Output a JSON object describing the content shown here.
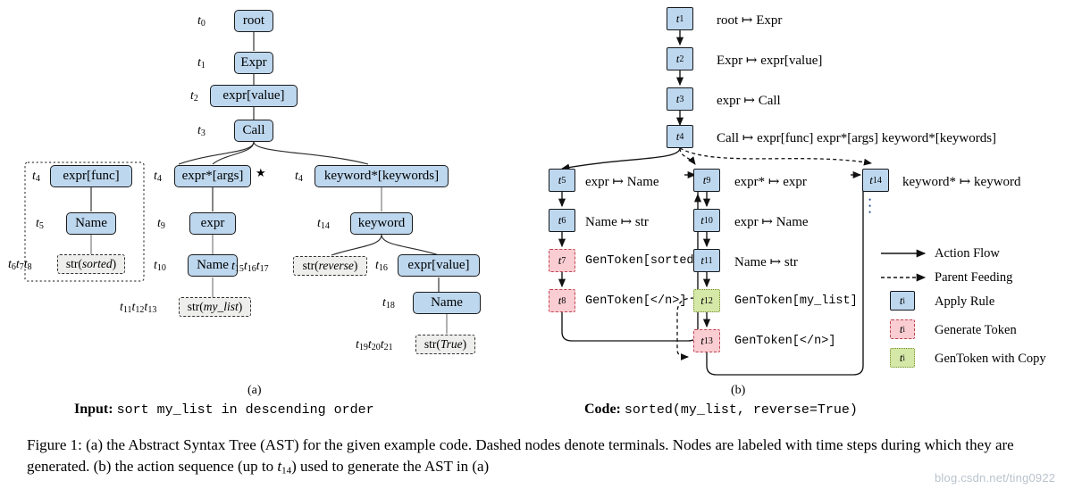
{
  "figure": {
    "panel_a_label": "(a)",
    "panel_b_label": "(b)",
    "input_prefix": "Input:",
    "input_code": "sort my_list in descending order",
    "code_prefix": "Code:",
    "code_text": "sorted(my_list, reverse=True)",
    "caption_part1": "Figure 1: (a) the Abstract Syntax Tree (AST) for the given example code. Dashed nodes denote terminals. Nodes are labeled with time steps during which they are generated. (b) the action sequence (up to ",
    "caption_t": "t",
    "caption_t_sub": "14",
    "caption_part2": ") used to generate the AST in (a)",
    "watermark": "blog.csdn.net/ting0922"
  },
  "colors": {
    "apply_rule_fill": "#bdd7ee",
    "apply_rule_border": "#15181c",
    "generate_token_fill": "#f9cdd2",
    "generate_token_border": "#c0424f",
    "gentoken_copy_fill": "#d6e8a8",
    "gentoken_copy_border": "#6f8f2a",
    "terminal_fill": "#eeeeec",
    "terminal_border": "#333333",
    "background": "#ffffff"
  },
  "ast": {
    "nodes": [
      {
        "id": "root",
        "label": "root",
        "time": "t0",
        "terminal": false
      },
      {
        "id": "expr_nt",
        "label": "Expr",
        "time": "t1",
        "terminal": false
      },
      {
        "id": "expr_value",
        "label": "expr[value]",
        "time": "t2",
        "terminal": false
      },
      {
        "id": "call",
        "label": "Call",
        "time": "t3",
        "terminal": false
      },
      {
        "id": "expr_func",
        "label": "expr[func]",
        "time": "t4",
        "terminal": false
      },
      {
        "id": "name1",
        "label": "Name",
        "time": "t5",
        "terminal": false
      },
      {
        "id": "str_sorted",
        "label": "str(sorted)",
        "time": "t6t7t8",
        "terminal": true
      },
      {
        "id": "expr_args",
        "label": "expr*[args]",
        "time": "t4",
        "terminal": false
      },
      {
        "id": "expr2",
        "label": "expr",
        "time": "t9",
        "terminal": false
      },
      {
        "id": "name2",
        "label": "Name",
        "time": "t10",
        "terminal": false
      },
      {
        "id": "str_mylist",
        "label": "str(my_list)",
        "time": "t11t12t13",
        "terminal": true
      },
      {
        "id": "kw_star",
        "label": "keyword*[keywords]",
        "time": "t4",
        "terminal": false
      },
      {
        "id": "keyword",
        "label": "keyword",
        "time": "t14",
        "terminal": false
      },
      {
        "id": "str_rev",
        "label": "str(reverse)",
        "time": "t15t16t17",
        "terminal": true
      },
      {
        "id": "expr_val2",
        "label": "expr[value]",
        "time": "t16",
        "terminal": false
      },
      {
        "id": "name3",
        "label": "Name",
        "time": "t18",
        "terminal": false
      },
      {
        "id": "str_true",
        "label": "str(True)",
        "time": "t19t20t21",
        "terminal": true
      }
    ],
    "star_marker": "★"
  },
  "actions": [
    {
      "step": "t1",
      "rule": "root ↦ Expr",
      "kind": "apply"
    },
    {
      "step": "t2",
      "rule": "Expr ↦ expr[value]",
      "kind": "apply"
    },
    {
      "step": "t3",
      "rule": "expr ↦ Call",
      "kind": "apply"
    },
    {
      "step": "t4",
      "rule": "Call ↦ expr[func]  expr*[args]  keyword*[keywords]",
      "kind": "apply"
    },
    {
      "step": "t5",
      "rule": "expr ↦ Name",
      "kind": "apply"
    },
    {
      "step": "t6",
      "rule": "Name ↦ str",
      "kind": "apply"
    },
    {
      "step": "t7",
      "rule": "GenToken[sorted]",
      "kind": "gen"
    },
    {
      "step": "t8",
      "rule": "GenToken[</n>]",
      "kind": "gen"
    },
    {
      "step": "t9",
      "rule": "expr* ↦ expr",
      "kind": "apply"
    },
    {
      "step": "t10",
      "rule": "expr ↦ Name",
      "kind": "apply"
    },
    {
      "step": "t11",
      "rule": "Name ↦ str",
      "kind": "apply"
    },
    {
      "step": "t12",
      "rule": "GenToken[my_list]",
      "kind": "copy"
    },
    {
      "step": "t13",
      "rule": "GenToken[</n>]",
      "kind": "gen"
    },
    {
      "step": "t14",
      "rule": "keyword* ↦ keyword",
      "kind": "apply"
    }
  ],
  "legend": [
    {
      "icon": "solid-arrow",
      "label": "Action Flow"
    },
    {
      "icon": "dashed-arrow",
      "label": "Parent Feeding"
    },
    {
      "icon": "blue-box",
      "label": "Apply Rule",
      "chip": "ti"
    },
    {
      "icon": "pink-box",
      "label": "Generate Token",
      "chip": "ti"
    },
    {
      "icon": "green-box",
      "label": "GenToken with Copy",
      "chip": "ti"
    }
  ]
}
